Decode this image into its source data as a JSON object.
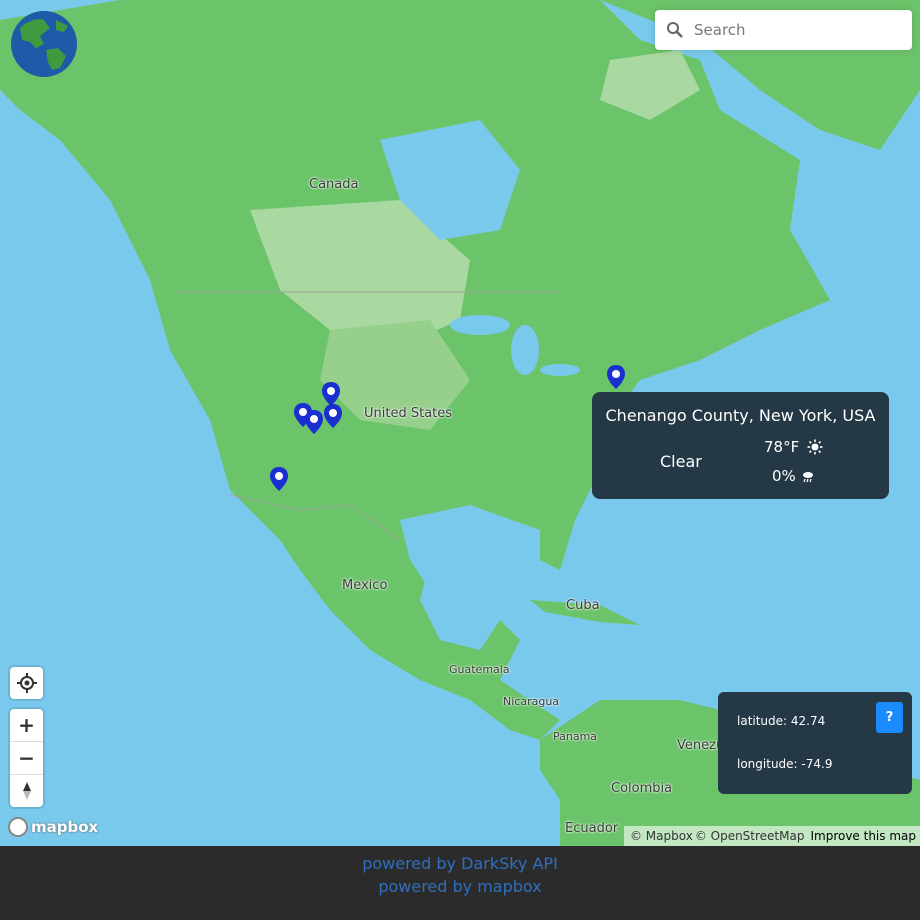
{
  "search": {
    "placeholder": "Search"
  },
  "map_labels": {
    "canada": "Canada",
    "united_states": "United States",
    "mexico": "Mexico",
    "cuba": "Cuba",
    "guatemala": "Guatemala",
    "nicaragua": "Nicaragua",
    "panama": "Panama",
    "venezuela": "Venezuela",
    "colombia": "Colombia",
    "ecuador": "Ecuador"
  },
  "markers": [
    "marker-pin-icon",
    "marker-pin-icon",
    "marker-pin-icon",
    "marker-pin-icon",
    "marker-pin-icon",
    "marker-pin-icon"
  ],
  "popup": {
    "location": "Chenango County, New York, USA",
    "condition": "Clear",
    "temperature": "78°F",
    "precipitation": "0%"
  },
  "coordinates": {
    "latitude": "latitude: 42.74",
    "longitude": "longitude: -74.9",
    "help_label": "?"
  },
  "controls": {
    "zoom_in": "+",
    "zoom_out": "−"
  },
  "logo": {
    "text": "mapbox"
  },
  "attribution": {
    "mapbox": "© Mapbox",
    "osm": "© OpenStreetMap",
    "improve": "Improve this map"
  },
  "footer": {
    "darksky": "powered by DarkSky API",
    "mapbox": "powered by mapbox"
  },
  "colors": {
    "water": "#79c9ec",
    "land": "#6cc46a",
    "land_light": "#a9d9a0",
    "panel": "#243845",
    "marker": "#1a2fcf",
    "link": "#2f6fbf"
  }
}
